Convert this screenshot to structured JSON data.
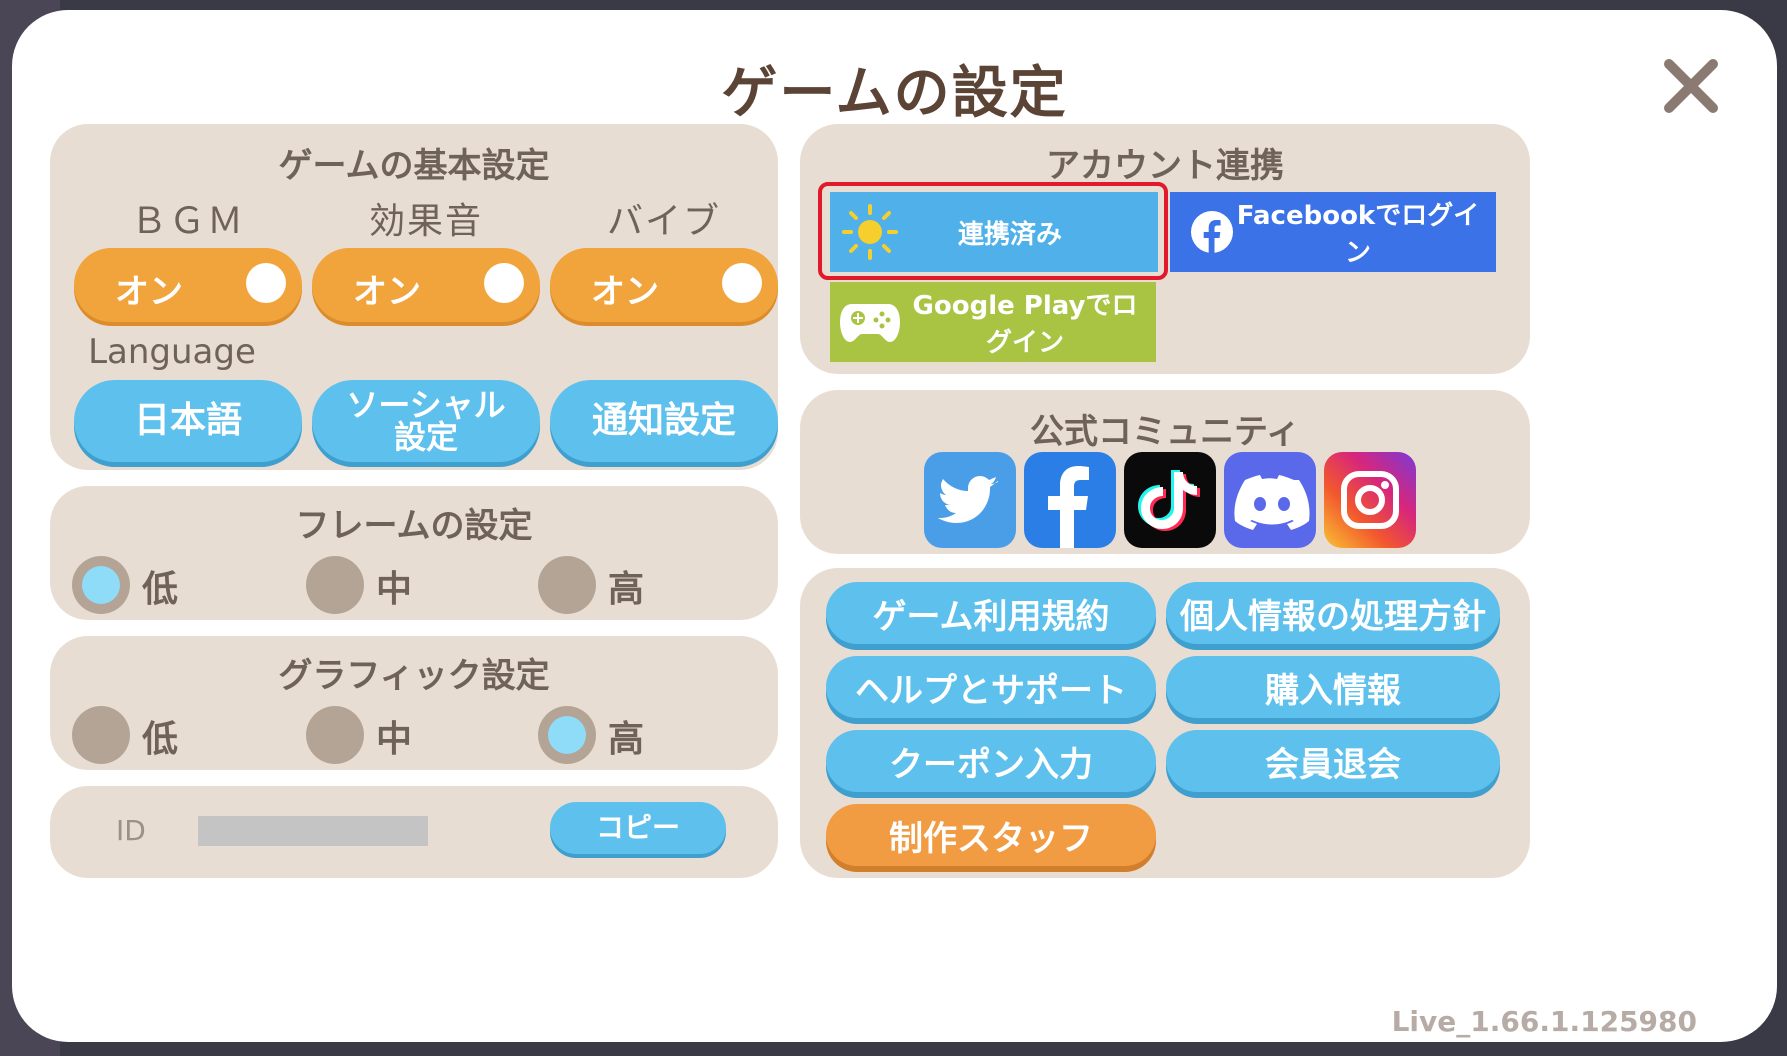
{
  "title": "ゲームの設定",
  "basic": {
    "title": "ゲームの基本設定",
    "bgm_label": "ＢＧＭ",
    "se_label": "効果音",
    "vibe_label": "バイブ",
    "bgm_toggle": "オン",
    "se_toggle": "オン",
    "vibe_toggle": "オン",
    "language_label": "Language",
    "language_button": "日本語",
    "social_button": "ソーシャル\n設定",
    "social_line1": "ソーシャル",
    "social_line2": "設定",
    "notify_button": "通知設定"
  },
  "frame": {
    "title": "フレームの設定",
    "options": [
      "低",
      "中",
      "高"
    ],
    "selected": "低"
  },
  "graphics": {
    "title": "グラフィック設定",
    "options": [
      "低",
      "中",
      "高"
    ],
    "selected": "高"
  },
  "id_row": {
    "label": "ID",
    "copy_button": "コピー"
  },
  "account": {
    "title": "アカウント連携",
    "linked_button": "連携済み",
    "facebook_button": "Facebookでログイン",
    "google_button": "Google Playでログイン",
    "colors": {
      "linked": "#4fb0ea",
      "facebook": "#3b72e8",
      "google": "#a9c443",
      "highlight": "#e2192a"
    }
  },
  "community": {
    "title": "公式コミュニティ",
    "icons": [
      "twitter-icon",
      "facebook-icon",
      "tiktok-icon",
      "discord-icon",
      "instagram-icon"
    ]
  },
  "links": {
    "terms": "ゲーム利用規約",
    "privacy": "個人情報の処理方針",
    "help": "ヘルプとサポート",
    "purchase": "購入情報",
    "coupon": "クーポン入力",
    "withdraw": "会員退会",
    "staff": "制作スタッフ"
  },
  "version": "Live_1.66.1.125980"
}
